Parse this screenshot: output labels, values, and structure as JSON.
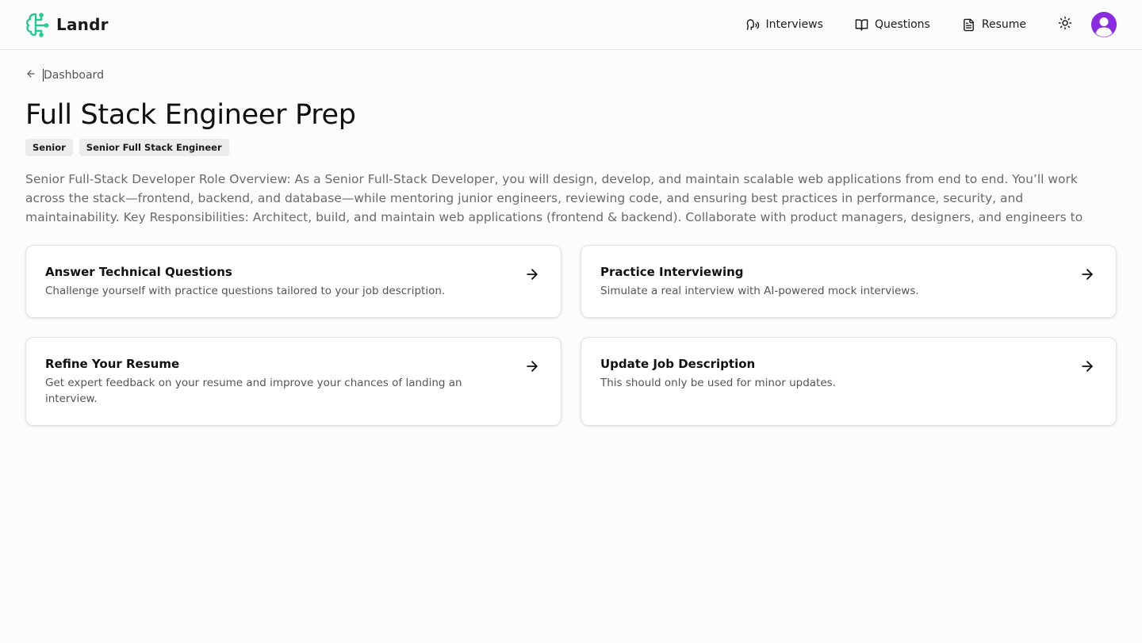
{
  "app": {
    "name": "Landr",
    "logo_icon": "brain-circuit-icon",
    "accent_color": "#22c993"
  },
  "nav": {
    "items": [
      {
        "label": "Interviews",
        "icon": "speech-icon"
      },
      {
        "label": "Questions",
        "icon": "book-open-icon"
      },
      {
        "label": "Resume",
        "icon": "file-text-icon"
      }
    ],
    "theme_icon": "sun-icon",
    "avatar_color": "#8a2be2"
  },
  "breadcrumb": {
    "back_label": "Dashboard",
    "icon": "arrow-left-icon"
  },
  "page": {
    "title": "Full Stack Engineer Prep",
    "badges": [
      "Senior",
      "Senior Full Stack Engineer"
    ],
    "description": "Senior Full-Stack Developer Role Overview: As a Senior Full-Stack Developer, you will design, develop, and maintain scalable web applications from end to end. You’ll work across the stack—frontend, backend, and database—while mentoring junior engineers, reviewing code, and ensuring best practices in performance, security, and maintainability. Key Responsibilities: Architect, build, and maintain web applications (frontend & backend). Collaborate with product managers, designers, and engineers to deliver features. Optimize…"
  },
  "cards": [
    {
      "title": "Answer Technical Questions",
      "text": "Challenge yourself with practice questions tailored to your job description.",
      "icon": "arrow-right-icon"
    },
    {
      "title": "Practice Interviewing",
      "text": "Simulate a real interview with AI-powered mock interviews.",
      "icon": "arrow-right-icon"
    },
    {
      "title": "Refine Your Resume",
      "text": "Get expert feedback on your resume and improve your chances of landing an interview.",
      "icon": "arrow-right-icon"
    },
    {
      "title": "Update Job Description",
      "text": "This should only be used for minor updates.",
      "icon": "arrow-right-icon"
    }
  ]
}
